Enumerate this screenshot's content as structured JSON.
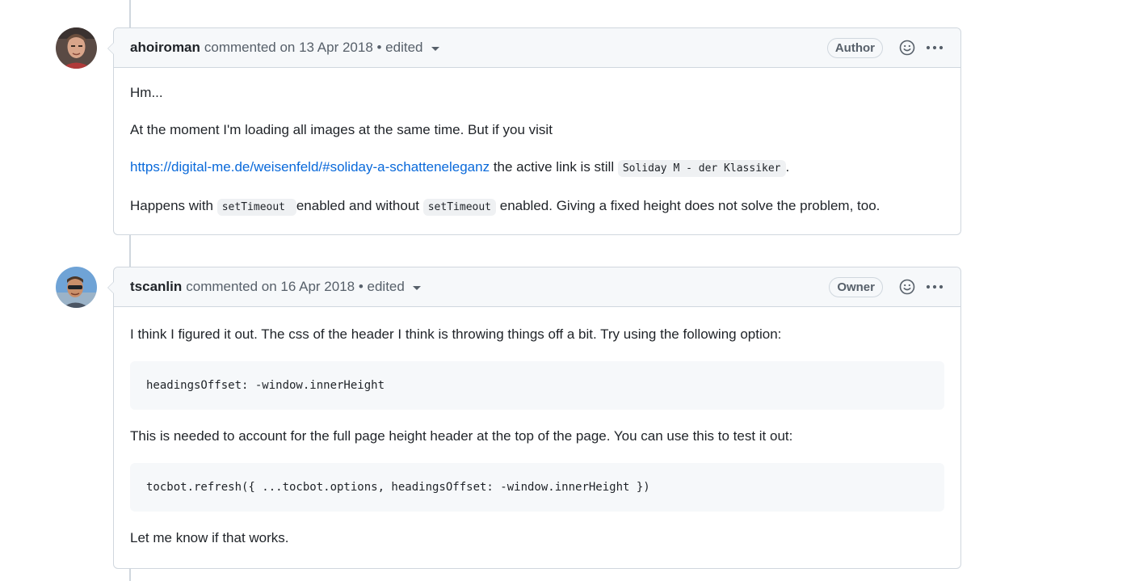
{
  "comments": [
    {
      "author": "ahoiroman",
      "meta": "commented on 13 Apr 2018 • edited",
      "role": "Author",
      "body": {
        "p1": "Hm...",
        "p2": "At the moment I'm loading all images at the same time. But if you visit",
        "link": "https://digital-me.de/weisenfeld/#soliday-a-schatteneleganz",
        "p3_mid": " the active link is still ",
        "code_active": "Soliday M - der Klassiker",
        "p3_end": ".",
        "p4_a": "Happens with ",
        "code_set1": "setTimeout ",
        "p4_b": " enabled and without ",
        "code_set2": "setTimeout",
        "p4_c": " enabled. Giving a fixed height does not solve the problem, too."
      }
    },
    {
      "author": "tscanlin",
      "meta": "commented on 16 Apr 2018 • edited",
      "role": "Owner",
      "body": {
        "p1": "I think I figured it out. The css of the header I think is throwing things off a bit. Try using the following option:",
        "code1": "headingsOffset: -window.innerHeight",
        "p2": "This is needed to account for the full page height header at the top of the page. You can use this to test it out:",
        "code2": "tocbot.refresh({ ...tocbot.options, headingsOffset: -window.innerHeight })",
        "p3": "Let me know if that works."
      }
    }
  ],
  "icons": {
    "reaction": "smiley-icon",
    "more": "kebab-horizontal-icon",
    "edited_menu": "triangle-down-icon"
  },
  "colors": {
    "link": "#0969da",
    "border": "#d0d7de",
    "header_bg": "#f6f8fa"
  }
}
